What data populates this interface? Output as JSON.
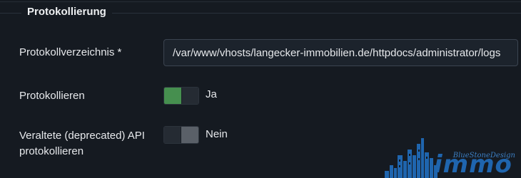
{
  "fieldset": {
    "legend": "Protokollierung"
  },
  "fields": {
    "log_directory": {
      "label": "Protokollverzeichnis *",
      "value": "/var/www/vhosts/langecker-immobilien.de/httpdocs/administrator/logs"
    },
    "logging": {
      "label": "Protokollieren",
      "state_label": "Ja",
      "enabled": true
    },
    "deprecated_api": {
      "label_line1": "Veraltete (deprecated) API",
      "label_line2": "protokollieren",
      "state_label": "Nein",
      "enabled": false
    }
  },
  "watermark": {
    "brand": "BlueStoneDesign",
    "word": "immo"
  },
  "colors": {
    "background": "#151a21",
    "switch_on": "#468f4f",
    "switch_off": "#5a6068",
    "watermark_blue": "#1f65ae"
  }
}
